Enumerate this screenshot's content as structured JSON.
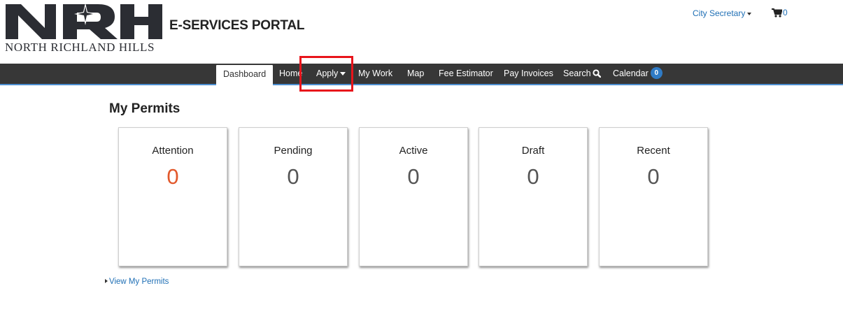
{
  "header": {
    "logo_text": "NRH",
    "logo_subtitle": "NORTH RICHLAND HILLS",
    "portal_title": "E-SERVICES PORTAL",
    "user_menu_label": "City Secretary",
    "cart_count": "0"
  },
  "nav": {
    "items": [
      {
        "label": "Dashboard",
        "active": true
      },
      {
        "label": "Home"
      },
      {
        "label": "Apply",
        "has_dropdown": true
      },
      {
        "label": "My Work"
      },
      {
        "label": "Map"
      },
      {
        "label": "Fee Estimator"
      },
      {
        "label": "Pay Invoices"
      },
      {
        "label": "Search",
        "icon": "search-icon"
      },
      {
        "label": "Calendar",
        "badge": "0"
      }
    ]
  },
  "main": {
    "section_title": "My Permits",
    "cards": [
      {
        "label": "Attention",
        "count": "0"
      },
      {
        "label": "Pending",
        "count": "0"
      },
      {
        "label": "Active",
        "count": "0"
      },
      {
        "label": "Draft",
        "count": "0"
      },
      {
        "label": "Recent",
        "count": "0"
      }
    ],
    "view_link": "View My Permits"
  },
  "colors": {
    "navbar_bg": "#373737",
    "nav_accent": "#4d8fd1",
    "link": "#1f6fb5",
    "attention_count": "#e2582b",
    "count": "#555555",
    "highlight_box": "#e8141b",
    "badge": "#2f7bc6"
  }
}
